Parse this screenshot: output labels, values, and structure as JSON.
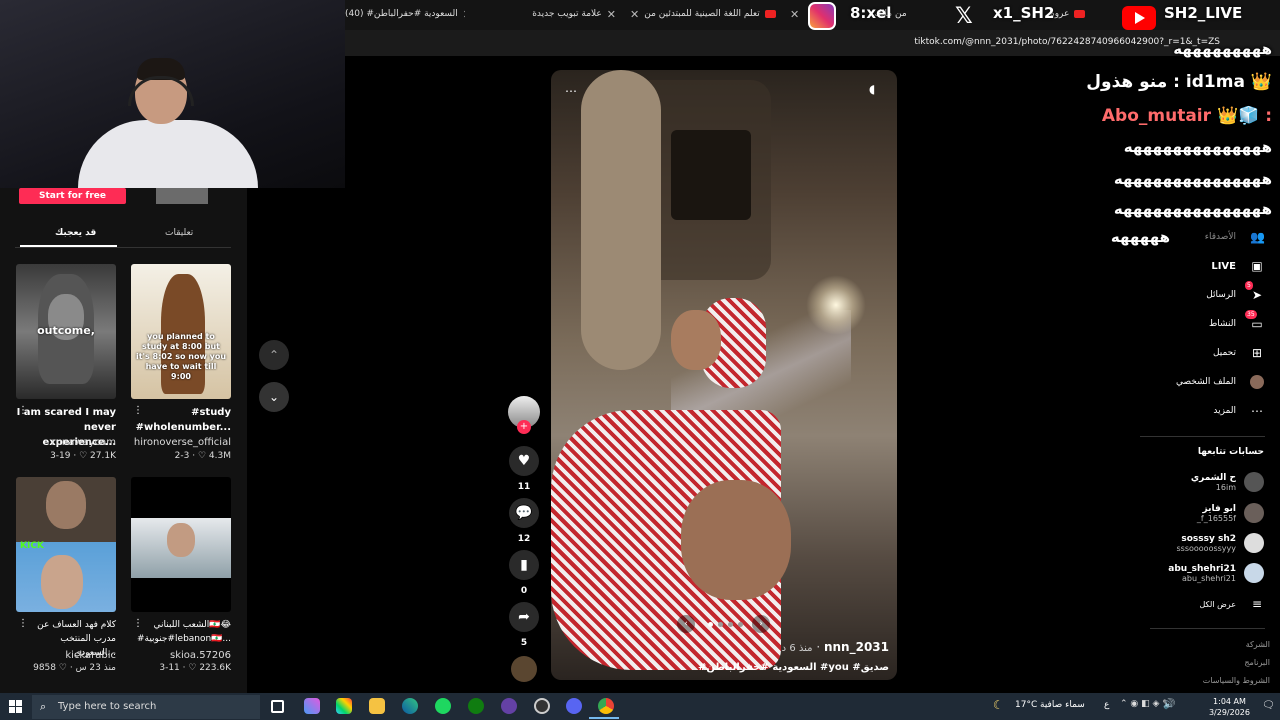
{
  "browser": {
    "tabs": [
      {
        "title": "(40) #السعودية #حفرالباطن"
      },
      {
        "title": "علامة تبويب جديدة"
      },
      {
        "title": "تعلم اللغة الصينية للمبتدئين من"
      },
      {
        "title": "من مالك"
      },
      {
        "title": "عروه"
      }
    ],
    "url": "tiktok.com/@nnn_2031/photo/7622428740966042900?_r=1&_t=ZS"
  },
  "overlays": {
    "instagram_handle": "8:xel",
    "x_handle": "x1_SH2",
    "youtube_handle": "SH2_LIVE"
  },
  "left_panel": {
    "start_button": "Start for free",
    "tabs": [
      "قد يعجبك",
      "تعليقات"
    ],
    "cards": [
      {
        "overlay": "outcome,",
        "title": "I am scared I may never experience...",
        "user": "runawaycam",
        "date": "3-19",
        "likes": "27.1K"
      },
      {
        "overlay": "you planned to study at 8:00 but it's 8:02 so now you have to wait till 9:00",
        "title": "#study #wholenumber...",
        "user": "hironoverse_official",
        "date": "2-3",
        "likes": "4.3M"
      },
      {
        "overlay": "KICK",
        "title": "كلام فهد العساف عن مدرب المنتخب السعودي...",
        "user": "kickarabic",
        "date": "منذ 23 س",
        "likes": "9858"
      },
      {
        "overlay": "",
        "title": "الشعب اللبناني🇱🇧😂 #جنوبية#lebanon🇱🇧...",
        "user": "skioa.57206",
        "date": "3-11",
        "likes": "223.6K"
      }
    ]
  },
  "post": {
    "author": "nnn_2031",
    "time_ago": "منذ 6 د",
    "caption": "#السعودية #حفرالباطن #you #صديق",
    "likes": "11",
    "comments": "12",
    "saves": "0",
    "shares": "5"
  },
  "chat": {
    "lines": [
      "هههههههههه",
      "منو هذول : id1ma 👑",
      "Abo_mutair 👑🧊 :",
      "ههههههههههههههه",
      "هههههههههههههههه",
      "هههههههههههههههه",
      "هههههه"
    ]
  },
  "right_nav": {
    "items": [
      {
        "label": "الأصدقاء",
        "icon": "friends-icon",
        "badge": ""
      },
      {
        "label": "LIVE",
        "icon": "live-icon",
        "badge": ""
      },
      {
        "label": "الرسائل",
        "icon": "messages-icon",
        "badge": "5"
      },
      {
        "label": "النشاط",
        "icon": "activity-icon",
        "badge": "35"
      },
      {
        "label": "تحميل",
        "icon": "upload-icon",
        "badge": ""
      },
      {
        "label": "الملف الشخصي",
        "icon": "profile-icon",
        "badge": ""
      },
      {
        "label": "المزيد",
        "icon": "more-icon",
        "badge": ""
      }
    ],
    "following_title": "حسابات تتابعها",
    "following": [
      {
        "name": "ح الشمري",
        "handle": "16im"
      },
      {
        "name": "ابو فايز",
        "handle": "_f_16555f"
      },
      {
        "name": "sosssy sh2",
        "handle": "sssooooossyyy"
      },
      {
        "name": "abu_shehri21",
        "handle": "abu_shehri21"
      }
    ],
    "show_all": "عرض الكل",
    "footer": [
      "الشركة",
      "البرنامج",
      "الشروط والسياسات"
    ]
  },
  "taskbar": {
    "search_placeholder": "Type here to search",
    "weather_temp": "17°C",
    "weather_desc": "سماء صافية",
    "time": "1:04 AM",
    "date": "3/29/2026",
    "lang": "ع"
  },
  "colors": {
    "accent": "#fe2c55",
    "background": "#000000",
    "panel": "#121212"
  }
}
